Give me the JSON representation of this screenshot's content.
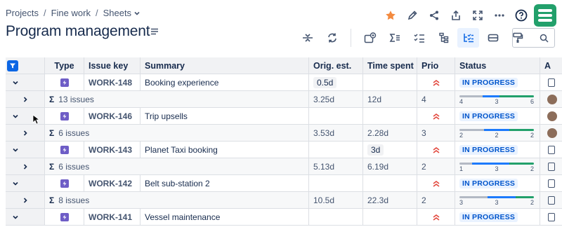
{
  "breadcrumb": {
    "projects": "Projects",
    "sep": "/",
    "fine_work": "Fine work",
    "sheets": "Sheets"
  },
  "page": {
    "title": "Program management"
  },
  "icons": {
    "top": [
      "star-icon",
      "edit-icon",
      "share-icon",
      "export-icon",
      "fullscreen-icon",
      "more-icon",
      "help-icon",
      "app-logo"
    ],
    "toolbar": [
      "row-height-icon",
      "refresh-icon",
      "add-dependency-icon",
      "sum-icon",
      "checklist-icon",
      "hierarchy-icon",
      "tree-view-icon",
      "card-view-icon",
      "paint-format-icon"
    ]
  },
  "colors": {
    "accent": "#0c66e4",
    "star": "#f38a3f",
    "app": "#22a06b",
    "status": "#0055cc"
  },
  "search": {
    "value": ""
  },
  "columns": {
    "type": "Type",
    "key": "Issue key",
    "summary": "Summary",
    "orig": "Orig. est.",
    "time": "Time spent",
    "prio": "Prio",
    "status": "Status",
    "extra": "A"
  },
  "rows": [
    {
      "key": "WORK-148",
      "summary": "Booking experience",
      "orig": "0.5d",
      "time": "",
      "status": "IN PROGRESS",
      "sum": {
        "count": "13 issues",
        "orig": "3.25d",
        "time": "12d",
        "prio": "4",
        "progress": {
          "todo": 4,
          "in_progress": 3,
          "done": 6
        },
        "labels": [
          "4",
          "3",
          "6"
        ]
      }
    },
    {
      "key": "WORK-146",
      "summary": "Trip upsells",
      "orig": "",
      "time": "",
      "status": "IN PROGRESS",
      "sum": {
        "count": "6 issues",
        "orig": "3.53d",
        "time": "2.28d",
        "prio": "3",
        "progress": {
          "todo": 2,
          "in_progress": 2,
          "done": 2
        },
        "labels": [
          "2",
          "2",
          "2"
        ]
      }
    },
    {
      "key": "WORK-143",
      "summary": "Planet Taxi booking",
      "orig": "",
      "time": "3d",
      "status": "IN PROGRESS",
      "sum": {
        "count": "6 issues",
        "orig": "5.13d",
        "time": "6.19d",
        "prio": "2",
        "progress": {
          "todo": 1,
          "in_progress": 3,
          "done": 2
        },
        "labels": [
          "1",
          "3",
          "2"
        ]
      }
    },
    {
      "key": "WORK-142",
      "summary": "Belt sub-station 2",
      "orig": "",
      "time": "",
      "status": "IN PROGRESS",
      "sum": {
        "count": "8 issues",
        "orig": "10.5d",
        "time": "22.3d",
        "prio": "2",
        "progress": {
          "todo": 3,
          "in_progress": 3,
          "done": 2
        },
        "labels": [
          "3",
          "3",
          "2"
        ]
      }
    },
    {
      "key": "WORK-141",
      "summary": "Vessel maintenance",
      "orig": "",
      "time": "",
      "status": "IN PROGRESS"
    }
  ]
}
